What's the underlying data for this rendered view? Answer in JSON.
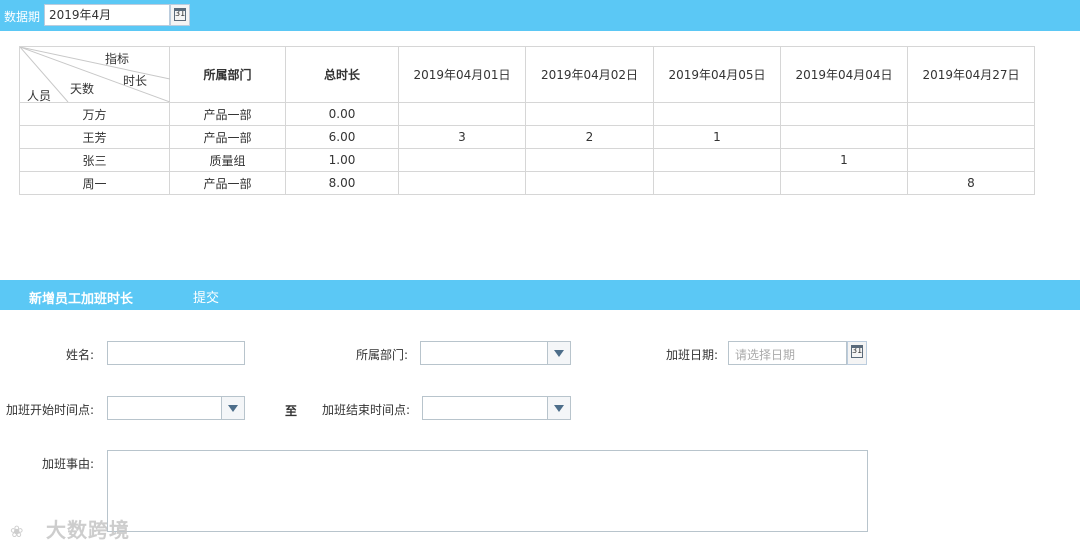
{
  "filter": {
    "label": "数据期",
    "period_value": "2019年4月",
    "calendar_day": "31"
  },
  "table": {
    "corner": {
      "metric": "指标",
      "duration": "时长",
      "days": "天数",
      "person": "人员"
    },
    "headers": [
      "所属部门",
      "总时长",
      "2019年04月01日",
      "2019年04月02日",
      "2019年04月05日",
      "2019年04月04日",
      "2019年04月27日"
    ],
    "rows": [
      {
        "name": "万方",
        "dept": "产品一部",
        "total": "0.00",
        "days": [
          "",
          "",
          "",
          "",
          ""
        ]
      },
      {
        "name": "王芳",
        "dept": "产品一部",
        "total": "6.00",
        "days": [
          "3",
          "2",
          "1",
          "",
          ""
        ]
      },
      {
        "name": "张三",
        "dept": "质量组",
        "total": "1.00",
        "days": [
          "",
          "",
          "",
          "1",
          ""
        ]
      },
      {
        "name": "周一",
        "dept": "产品一部",
        "total": "8.00",
        "days": [
          "",
          "",
          "",
          "",
          "8"
        ]
      }
    ]
  },
  "form": {
    "section_title": "新增员工加班时长",
    "submit_label": "提交",
    "name_label": "姓名:",
    "dept_label": "所属部门:",
    "date_label": "加班日期:",
    "date_placeholder": "请选择日期",
    "start_label": "加班开始时间点:",
    "to_label": "至",
    "end_label": "加班结束时间点:",
    "reason_label": "加班事由:"
  },
  "watermark": {
    "text": "大数跨境"
  },
  "colors": {
    "accent": "#5bc8f5",
    "border": "#d6d6d6"
  }
}
